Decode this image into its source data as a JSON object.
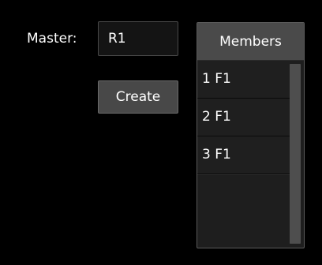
{
  "master": {
    "label": "Master:",
    "value": "R1"
  },
  "create_button": {
    "label": "Create"
  },
  "members": {
    "header": "Members",
    "items": [
      {
        "label": "1 F1"
      },
      {
        "label": "2 F1"
      },
      {
        "label": "3 F1"
      }
    ]
  },
  "colors": {
    "background": "#000000",
    "panel": "#1e1e1e",
    "header": "#4a4a4a",
    "button": "#484848",
    "text": "#ffffff"
  }
}
